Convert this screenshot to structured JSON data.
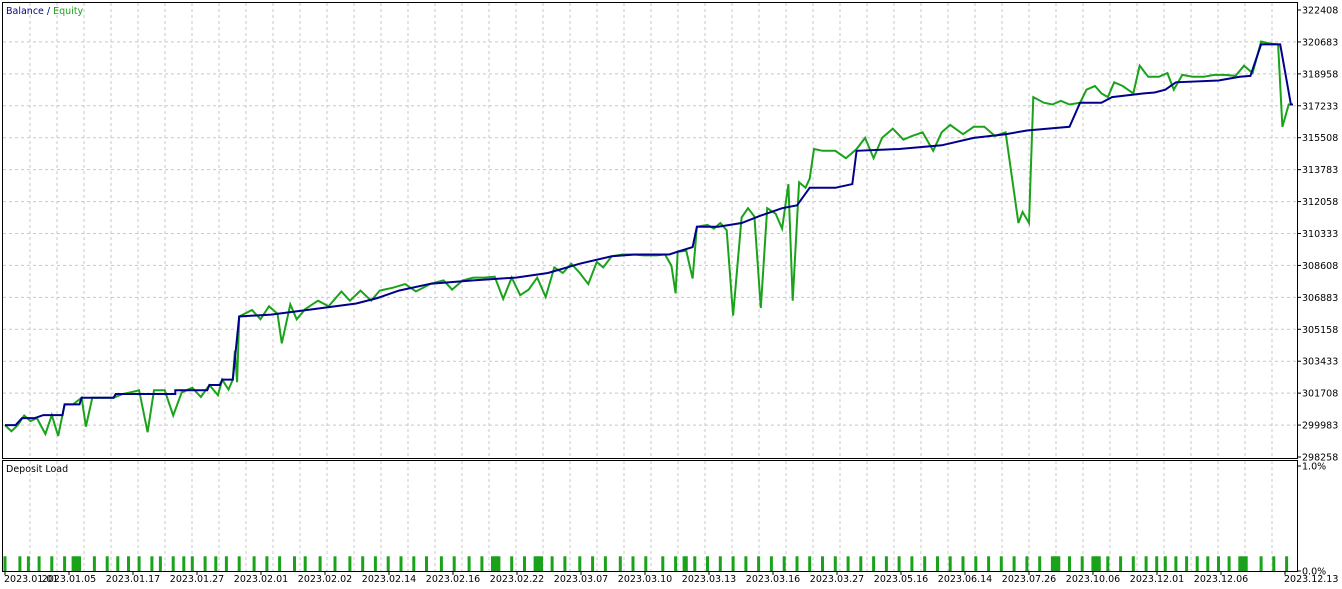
{
  "colors": {
    "background": "#ffffff",
    "frame": "#000000",
    "grid": "#c8c8c8",
    "balance": "#00008b",
    "equity": "#1aa31a",
    "deposit_load": "#1aa31a",
    "text": "#000000"
  },
  "chart_data": [
    {
      "type": "line",
      "legend": {
        "balance_label": "Balance",
        "separator": " / ",
        "equity_label": "Equity",
        "placement": "top-left"
      },
      "y_ticks": [
        "322408",
        "320683",
        "318958",
        "317233",
        "315508",
        "313783",
        "312058",
        "310333",
        "308608",
        "306883",
        "305158",
        "303433",
        "301708",
        "299983",
        "298258"
      ],
      "ylim": [
        298258,
        322408
      ],
      "grid": true,
      "n_points": 320,
      "balance": [
        [
          0,
          299983
        ],
        [
          5,
          299983
        ],
        [
          8,
          300360
        ],
        [
          14,
          300360
        ],
        [
          18,
          300520
        ],
        [
          27,
          300520
        ],
        [
          28,
          301100
        ],
        [
          35,
          301100
        ],
        [
          36,
          301460
        ],
        [
          51,
          301460
        ],
        [
          52,
          301660
        ],
        [
          80,
          301660
        ],
        [
          80,
          301860
        ],
        [
          95,
          301860
        ],
        [
          96,
          302150
        ],
        [
          101,
          302150
        ],
        [
          102,
          302440
        ],
        [
          107,
          302440
        ],
        [
          110,
          305850
        ],
        [
          125,
          305950
        ],
        [
          145,
          306250
        ],
        [
          165,
          306550
        ],
        [
          175,
          306850
        ],
        [
          185,
          307250
        ],
        [
          200,
          307620
        ],
        [
          220,
          307800
        ],
        [
          240,
          307950
        ],
        [
          255,
          308200
        ],
        [
          270,
          308700
        ],
        [
          285,
          309100
        ],
        [
          296,
          309200
        ],
        [
          312,
          309200
        ],
        [
          316,
          309350
        ],
        [
          323,
          309600
        ],
        [
          325,
          310700
        ],
        [
          335,
          310700
        ],
        [
          346,
          310900
        ],
        [
          355,
          311300
        ],
        [
          365,
          311700
        ],
        [
          372,
          311850
        ],
        [
          378,
          312800
        ],
        [
          390,
          312800
        ],
        [
          398,
          313000
        ],
        [
          400,
          314800
        ],
        [
          420,
          314900
        ],
        [
          440,
          315100
        ],
        [
          455,
          315500
        ],
        [
          470,
          315700
        ],
        [
          480,
          315900
        ],
        [
          490,
          316000
        ],
        [
          500,
          316100
        ],
        [
          505,
          317400
        ],
        [
          515,
          317400
        ],
        [
          520,
          317700
        ],
        [
          535,
          317900
        ],
        [
          540,
          317950
        ],
        [
          545,
          318100
        ],
        [
          550,
          318500
        ],
        [
          570,
          318600
        ],
        [
          580,
          318800
        ],
        [
          585,
          318850
        ],
        [
          590,
          320550
        ],
        [
          599,
          320550
        ],
        [
          604,
          317300
        ],
        [
          605,
          317300
        ]
      ],
      "equity": [
        [
          0,
          299983
        ],
        [
          3,
          299650
        ],
        [
          6,
          299983
        ],
        [
          9,
          300500
        ],
        [
          12,
          300200
        ],
        [
          15,
          300360
        ],
        [
          19,
          299500
        ],
        [
          22,
          300520
        ],
        [
          25,
          299400
        ],
        [
          28,
          301100
        ],
        [
          32,
          301100
        ],
        [
          36,
          301460
        ],
        [
          38,
          299900
        ],
        [
          41,
          301460
        ],
        [
          51,
          301460
        ],
        [
          55,
          301650
        ],
        [
          59,
          301750
        ],
        [
          63,
          301860
        ],
        [
          67,
          299600
        ],
        [
          70,
          301860
        ],
        [
          75,
          301860
        ],
        [
          79,
          300500
        ],
        [
          83,
          301750
        ],
        [
          88,
          302000
        ],
        [
          92,
          301500
        ],
        [
          96,
          302150
        ],
        [
          100,
          301600
        ],
        [
          102,
          302440
        ],
        [
          105,
          301900
        ],
        [
          107,
          302440
        ],
        [
          108,
          304000
        ],
        [
          109,
          302300
        ],
        [
          110,
          305850
        ],
        [
          116,
          306200
        ],
        [
          120,
          305700
        ],
        [
          124,
          306400
        ],
        [
          128,
          306000
        ],
        [
          130,
          304400
        ],
        [
          134,
          306500
        ],
        [
          137,
          305700
        ],
        [
          141,
          306250
        ],
        [
          147,
          306700
        ],
        [
          152,
          306400
        ],
        [
          158,
          307200
        ],
        [
          162,
          306700
        ],
        [
          167,
          307250
        ],
        [
          172,
          306700
        ],
        [
          176,
          307250
        ],
        [
          182,
          307400
        ],
        [
          188,
          307600
        ],
        [
          193,
          307200
        ],
        [
          200,
          307620
        ],
        [
          206,
          307800
        ],
        [
          210,
          307300
        ],
        [
          215,
          307800
        ],
        [
          220,
          307950
        ],
        [
          225,
          307950
        ],
        [
          230,
          308000
        ],
        [
          234,
          306800
        ],
        [
          238,
          307950
        ],
        [
          242,
          307000
        ],
        [
          246,
          307300
        ],
        [
          250,
          307950
        ],
        [
          254,
          306900
        ],
        [
          258,
          308500
        ],
        [
          262,
          308200
        ],
        [
          266,
          308700
        ],
        [
          270,
          308200
        ],
        [
          274,
          307600
        ],
        [
          278,
          308800
        ],
        [
          281,
          308500
        ],
        [
          285,
          309100
        ],
        [
          290,
          309200
        ],
        [
          295,
          309200
        ],
        [
          300,
          309150
        ],
        [
          306,
          309150
        ],
        [
          310,
          309200
        ],
        [
          313,
          308600
        ],
        [
          315,
          307100
        ],
        [
          316,
          309350
        ],
        [
          320,
          309400
        ],
        [
          323,
          307900
        ],
        [
          325,
          310700
        ],
        [
          330,
          310800
        ],
        [
          333,
          310600
        ],
        [
          336,
          310900
        ],
        [
          339,
          310500
        ],
        [
          342,
          305900
        ],
        [
          346,
          311200
        ],
        [
          349,
          311700
        ],
        [
          352,
          311250
        ],
        [
          355,
          306300
        ],
        [
          358,
          311700
        ],
        [
          362,
          311400
        ],
        [
          365,
          310600
        ],
        [
          368,
          313000
        ],
        [
          370,
          306700
        ],
        [
          373,
          313100
        ],
        [
          376,
          312800
        ],
        [
          378,
          313300
        ],
        [
          380,
          314900
        ],
        [
          384,
          314800
        ],
        [
          390,
          314800
        ],
        [
          395,
          314400
        ],
        [
          400,
          314900
        ],
        [
          404,
          315500
        ],
        [
          408,
          314400
        ],
        [
          412,
          315500
        ],
        [
          417,
          316000
        ],
        [
          422,
          315400
        ],
        [
          426,
          315600
        ],
        [
          431,
          315800
        ],
        [
          436,
          314800
        ],
        [
          440,
          315800
        ],
        [
          444,
          316200
        ],
        [
          450,
          315700
        ],
        [
          455,
          316100
        ],
        [
          460,
          316100
        ],
        [
          465,
          315600
        ],
        [
          470,
          315800
        ],
        [
          476,
          310900
        ],
        [
          478,
          311500
        ],
        [
          481,
          310900
        ],
        [
          483,
          317700
        ],
        [
          488,
          317400
        ],
        [
          492,
          317300
        ],
        [
          496,
          317500
        ],
        [
          500,
          317300
        ],
        [
          505,
          317400
        ],
        [
          508,
          318100
        ],
        [
          512,
          318300
        ],
        [
          515,
          317900
        ],
        [
          518,
          317700
        ],
        [
          521,
          318500
        ],
        [
          525,
          318300
        ],
        [
          530,
          317900
        ],
        [
          533,
          319400
        ],
        [
          537,
          318800
        ],
        [
          542,
          318800
        ],
        [
          546,
          319000
        ],
        [
          549,
          318100
        ],
        [
          553,
          318900
        ],
        [
          558,
          318800
        ],
        [
          563,
          318800
        ],
        [
          568,
          318900
        ],
        [
          573,
          318900
        ],
        [
          578,
          318850
        ],
        [
          582,
          319400
        ],
        [
          586,
          319000
        ],
        [
          590,
          320700
        ],
        [
          594,
          320600
        ],
        [
          598,
          320550
        ],
        [
          600,
          316100
        ],
        [
          603,
          317300
        ],
        [
          605,
          317300
        ]
      ]
    },
    {
      "type": "bar",
      "title": "Deposit Load",
      "y_ticks": [
        "1.0%",
        "0.0%"
      ],
      "ylim": [
        0,
        1.0
      ],
      "bar_value": 0.14,
      "bar_indices": [
        0,
        7,
        11,
        16,
        22,
        28,
        32,
        33,
        34,
        35,
        42,
        48,
        53,
        58,
        63,
        69,
        73,
        79,
        84,
        88,
        94,
        99,
        104,
        110,
        117,
        123,
        129,
        136,
        141,
        148,
        155,
        162,
        168,
        174,
        180,
        186,
        192,
        198,
        205,
        211,
        218,
        224,
        229,
        230,
        231,
        232,
        238,
        244,
        249,
        250,
        251,
        252,
        257,
        263,
        270,
        276,
        282,
        289,
        295,
        301,
        309,
        315,
        319,
        320,
        324,
        330,
        336,
        342,
        348,
        354,
        360,
        366,
        372,
        378,
        384,
        390,
        396,
        402,
        408,
        414,
        420,
        426,
        432,
        438,
        444,
        450,
        456,
        462,
        468,
        474,
        480,
        486,
        492,
        493,
        494,
        495,
        500,
        506,
        511,
        512,
        513,
        514,
        518,
        524,
        530,
        536,
        541,
        545,
        550,
        555,
        560,
        565,
        570,
        575,
        580,
        581,
        582,
        583,
        590,
        596,
        602
      ],
      "x_ticks": [
        "2023.01.01",
        "2023.01.05",
        "2023.01.17",
        "2023.01.27",
        "2023.02.01",
        "2023.02.02",
        "2023.02.14",
        "2023.02.16",
        "2023.02.22",
        "2023.03.07",
        "2023.03.10",
        "2023.03.13",
        "2023.03.16",
        "2023.03.27",
        "2023.05.16",
        "2023.06.14",
        "2023.07.26",
        "2023.10.06",
        "2023.12.01",
        "2023.12.06",
        "2023.12.13"
      ]
    }
  ]
}
